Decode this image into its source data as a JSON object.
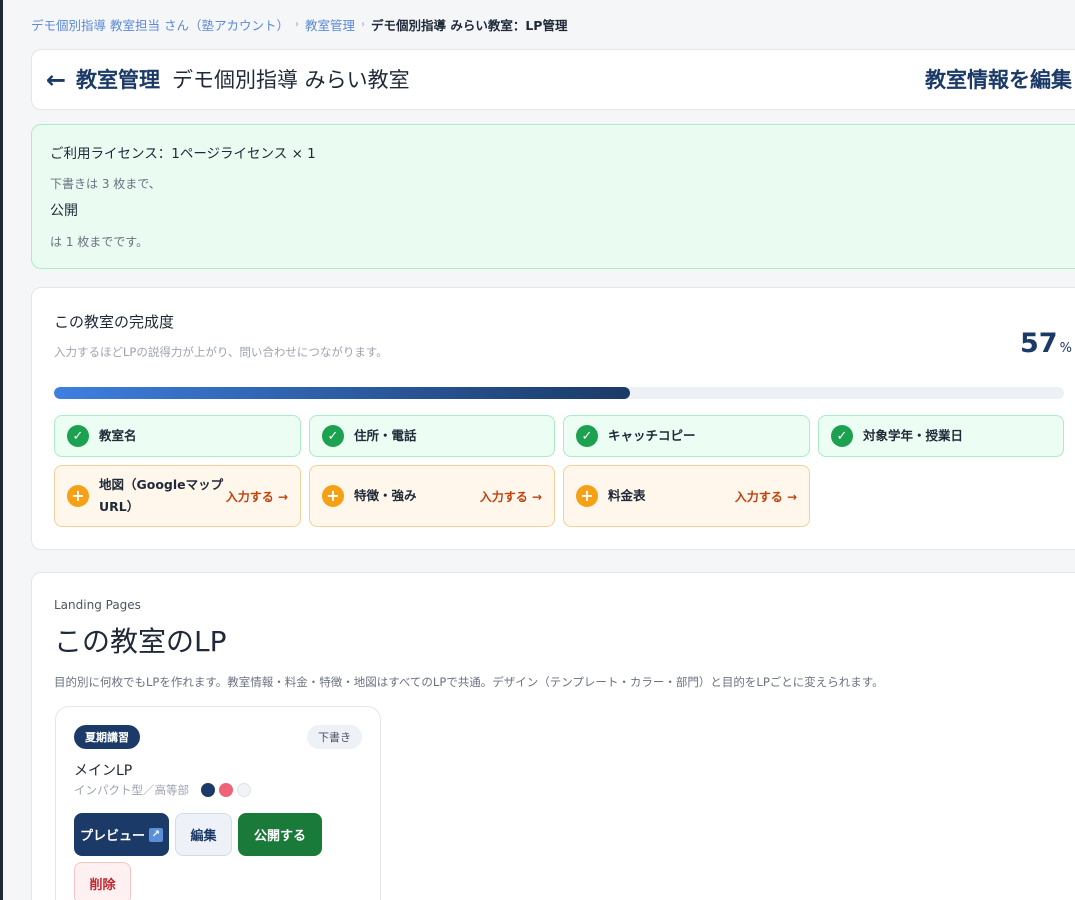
{
  "breadcrumb": {
    "items": [
      "デモ個別指導 教室担当 さん（塾アカウント）",
      "教室管理"
    ],
    "current": "デモ個別指導 みらい教室：LP管理",
    "separator": "›"
  },
  "header": {
    "back_icon": "←",
    "title": "教室管理",
    "subtitle": "デモ個別指導 みらい教室",
    "edit_label": "教室情報を編集"
  },
  "license": {
    "line1": "ご利用ライセンス：1ページライセンス × 1",
    "line2": "下書きは 3 枚まで、",
    "line3": "公開",
    "line4": "は 1 枚までです。"
  },
  "completion": {
    "title": "この教室の完成度",
    "description": "入力するほどLPの説得力が上がり、問い合わせにつながります。",
    "percent": "57",
    "percent_unit": "%",
    "done_icon": "✓",
    "todo_icon": "+",
    "items_done": [
      "教室名",
      "住所・電話",
      "キャッチコピー",
      "対象学年・授業日"
    ],
    "items_todo": [
      "地図（Googleマップ URL）",
      "特徴・強み",
      "料金表"
    ],
    "todo_action": "入力する →"
  },
  "lp_section": {
    "kicker": "Landing Pages",
    "title": "この教室のLP",
    "description": "目的別に何枚でもLPを作れます。教室情報・料金・特徴・地図はすべてのLPで共通。デザイン（テンプレート・カラー・部門）と目的をLPごとに変えられます。",
    "items": [
      {
        "tag": "夏期講習",
        "status": "下書き",
        "name": "メインLP",
        "meta": "インパクト型／高等部",
        "colors": [
          "#1b3a67",
          "#f06275",
          "#f1f3f7"
        ],
        "preview_label": "プレビュー",
        "preview_icon": "↗",
        "edit_label": "編集",
        "publish_label": "公開する",
        "delete_label": "削除"
      }
    ]
  }
}
